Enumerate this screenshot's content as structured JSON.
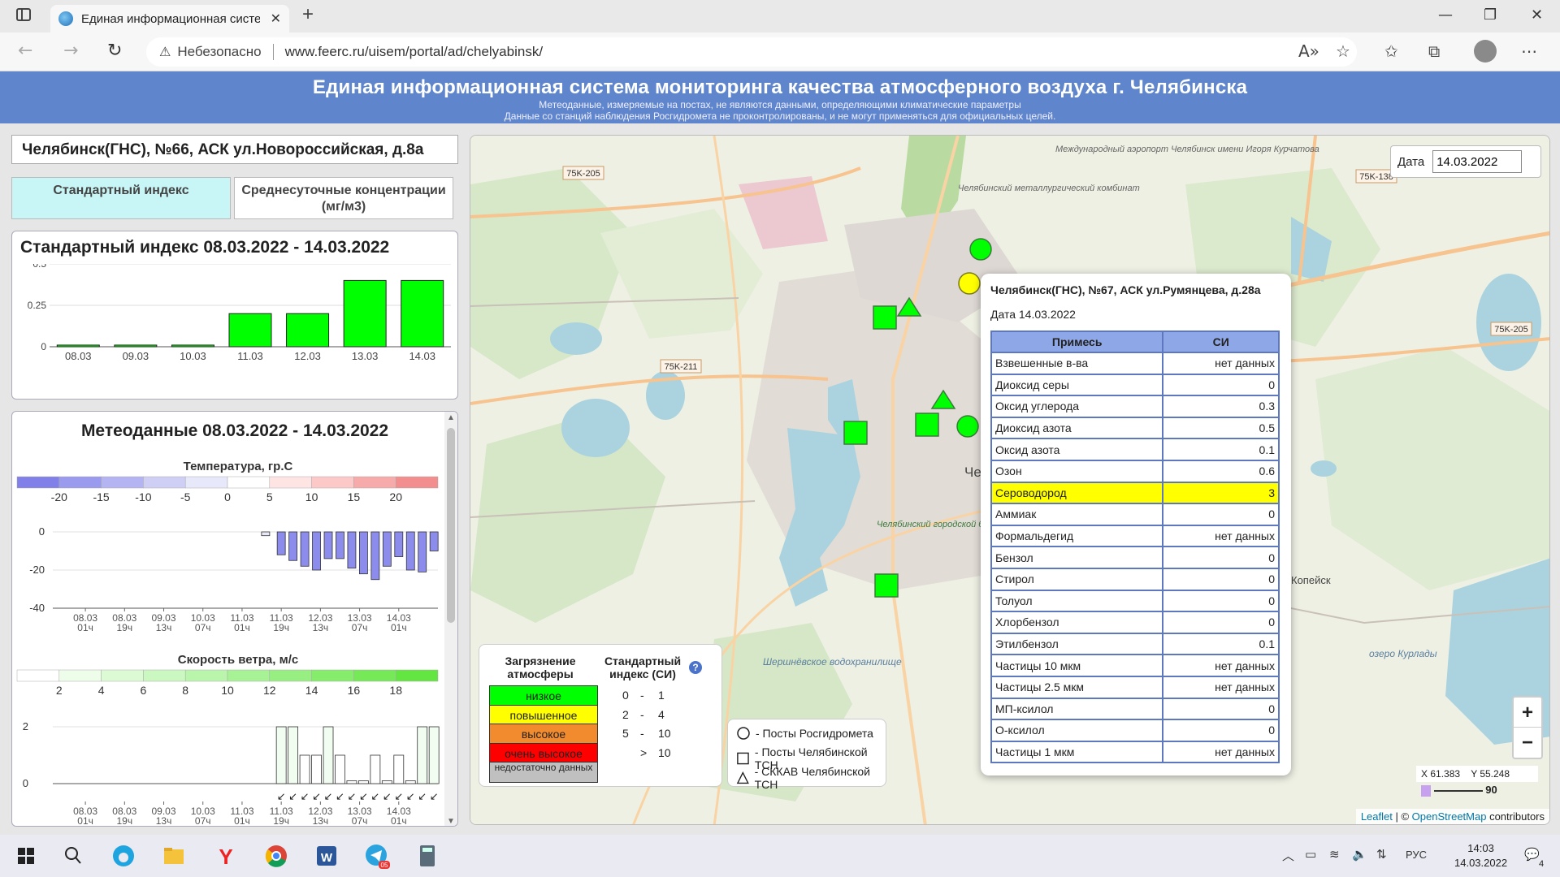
{
  "browser": {
    "tab_title": "Единая информационная систе",
    "insecure_label": "Небезопасно",
    "url": "www.feerc.ru/uisem/portal/ad/chelyabinsk/"
  },
  "page": {
    "title": "Единая информационная система мониторинга качества атмосферного воздуха г. Челябинска",
    "subtitle1": "Метеоданные, измеряемые на постах, не являются данными, определяющими климатические параметры",
    "subtitle2": "Данные со станций наблюдения Росгидромета не проконтролированы, и не могут применяться для официальных целей."
  },
  "station": {
    "title": "Челябинск(ГНС), №66, АСК ул.Новороссийская, д.8а",
    "tab_si": "Стандартный индекс",
    "tab_avg": "Среднесуточные концентрации (мг/м3)"
  },
  "si_chart_title": "Стандартный индекс 08.03.2022 - 14.03.2022",
  "meteo_title": "Метеоданные 08.03.2022 - 14.03.2022",
  "temperature": {
    "title": "Температура, гр.С",
    "scale_labels": [
      "-20",
      "-15",
      "-10",
      "-5",
      "0",
      "5",
      "10",
      "15",
      "20"
    ],
    "scale_colors": [
      "#8080e8",
      "#9a9aee",
      "#b4b4f2",
      "#cfcff6",
      "#e8e8fb",
      "#ffffff",
      "#ffe4e4",
      "#fcc8c8",
      "#f7aaaa",
      "#f28e8e"
    ]
  },
  "wind": {
    "title": "Скорость ветра, м/с",
    "scale_labels": [
      "2",
      "4",
      "6",
      "8",
      "10",
      "12",
      "14",
      "16",
      "18"
    ],
    "scale_colors": [
      "#ffffff",
      "#eefdea",
      "#dcfbd5",
      "#cbf8c0",
      "#b9f5ab",
      "#a8f296",
      "#97ef81",
      "#86ec6c",
      "#75e957",
      "#64e642"
    ]
  },
  "chart_data": [
    {
      "type": "bar",
      "title": "Стандартный индекс 08.03.2022 - 14.03.2022",
      "categories": [
        "08.03",
        "09.03",
        "10.03",
        "11.03",
        "12.03",
        "13.03",
        "14.03"
      ],
      "values": [
        0.01,
        0.01,
        0.01,
        0.2,
        0.2,
        0.4,
        0.4
      ],
      "ylim": [
        0,
        0.5
      ],
      "yticks": [
        "0",
        "0.25",
        "0.5"
      ],
      "color": "#00ff00"
    },
    {
      "type": "bar",
      "title": "Температура, гр.С",
      "x_labels": [
        [
          "08.03",
          "01ч"
        ],
        [
          "08.03",
          "19ч"
        ],
        [
          "09.03",
          "13ч"
        ],
        [
          "10.03",
          "07ч"
        ],
        [
          "11.03",
          "01ч"
        ],
        [
          "11.03",
          "19ч"
        ],
        [
          "12.03",
          "13ч"
        ],
        [
          "13.03",
          "07ч"
        ],
        [
          "14.03",
          "01ч"
        ]
      ],
      "x_range": [
        0,
        9.5
      ],
      "x": [
        5.5,
        5.8,
        6.1,
        6.4,
        6.7,
        7.0,
        7.3,
        7.6,
        7.9,
        8.2,
        8.5,
        8.8,
        9.1,
        9.4
      ],
      "values": [
        -2,
        -12,
        -15,
        -18,
        -20,
        -14,
        -14,
        -19,
        -22,
        -25,
        -18,
        -13,
        -20,
        -21,
        -10
      ],
      "yticks": [
        "0",
        "-20",
        "-40"
      ],
      "ylim": [
        -40,
        0
      ]
    },
    {
      "type": "bar",
      "title": "Скорость ветра, м/с",
      "x_labels": [
        [
          "08.03",
          "01ч"
        ],
        [
          "08.03",
          "19ч"
        ],
        [
          "09.03",
          "13ч"
        ],
        [
          "10.03",
          "07ч"
        ],
        [
          "11.03",
          "01ч"
        ],
        [
          "11.03",
          "19ч"
        ],
        [
          "12.03",
          "13ч"
        ],
        [
          "13.03",
          "07ч"
        ],
        [
          "14.03",
          "01ч"
        ]
      ],
      "x_range": [
        0,
        9.5
      ],
      "x": [
        5.5,
        5.8,
        6.1,
        6.4,
        6.7,
        7.0,
        7.3,
        7.6,
        7.9,
        8.2,
        8.5,
        8.8,
        9.1,
        9.4
      ],
      "values": [
        2,
        2,
        1,
        1,
        2,
        1,
        0.1,
        0.1,
        1,
        0.1,
        1,
        0.1,
        2,
        2
      ],
      "yticks": [
        "2",
        "0"
      ],
      "ylim": [
        0,
        2
      ]
    }
  ],
  "map": {
    "date_label": "Дата",
    "date_value": "14.03.2022",
    "road_labels": [
      "75K-205",
      "75K-138",
      "75K-211",
      "75K-205"
    ],
    "place_labels": [
      "Челябинский металлургический комбинат",
      "Международный аэропорт Челябинск имени Игоря Курчатова",
      "Челябинский городской бор",
      "Шершнёвское водохранилище",
      "Копейск",
      "озеро Курлады",
      "Чел"
    ],
    "coords": {
      "x_label": "X",
      "x_value": "61.383",
      "y_label": "Y",
      "y_value": "55.248"
    },
    "scale_value": "90",
    "attribution": {
      "leaflet": "Leaflet",
      "osm": "OpenStreetMap",
      "tail": "contributors"
    }
  },
  "popup": {
    "title": "Челябинск(ГНС), №67, АСК ул.Румянцева, д.28а",
    "date": "Дата 14.03.2022",
    "col1": "Примесь",
    "col2": "СИ",
    "rows": [
      {
        "name": "Взвешенные в-ва",
        "value": "нет данных"
      },
      {
        "name": "Диоксид серы",
        "value": "0"
      },
      {
        "name": "Оксид углерода",
        "value": "0.3"
      },
      {
        "name": "Диоксид азота",
        "value": "0.5"
      },
      {
        "name": "Оксид азота",
        "value": "0.1"
      },
      {
        "name": "Озон",
        "value": "0.6"
      },
      {
        "name": "Сероводород",
        "value": "3"
      },
      {
        "name": "Аммиак",
        "value": "0"
      },
      {
        "name": "Формальдегид",
        "value": "нет данных"
      },
      {
        "name": "Бензол",
        "value": "0"
      },
      {
        "name": "Стирол",
        "value": "0"
      },
      {
        "name": "Толуол",
        "value": "0"
      },
      {
        "name": "Хлорбензол",
        "value": "0"
      },
      {
        "name": "Этилбензол",
        "value": "0.1"
      },
      {
        "name": "Частицы 10 мкм",
        "value": "нет данных"
      },
      {
        "name": "Частицы 2.5 мкм",
        "value": "нет данных"
      },
      {
        "name": "МП-ксилол",
        "value": "0"
      },
      {
        "name": "О-ксилол",
        "value": "0"
      },
      {
        "name": "Частицы 1 мкм",
        "value": "нет данных"
      }
    ]
  },
  "legend": {
    "header1": "Загрязнение атмосферы",
    "header2": "Стандартный индекс (СИ)",
    "levels": [
      {
        "label": "низкое",
        "color": "#00ff00",
        "from": "0",
        "sep": "-",
        "to": "1"
      },
      {
        "label": "повышенное",
        "color": "#ffff00",
        "from": "2",
        "sep": "-",
        "to": "4"
      },
      {
        "label": "высокое",
        "color": "#f28a2e",
        "from": "5",
        "sep": "-",
        "to": "10"
      },
      {
        "label": "очень высокое",
        "color": "#ff0000",
        "from": "",
        "sep": ">",
        "to": "10"
      },
      {
        "label": "недостаточно данных",
        "color": "#c0c0c0",
        "from": "",
        "sep": "",
        "to": ""
      }
    ],
    "shapes": [
      {
        "symbol": "circle",
        "label": "- Посты Росгидромета"
      },
      {
        "symbol": "square",
        "label": "- Посты Челябинской ТСН"
      },
      {
        "symbol": "triangle",
        "label": "- СККАВ Челябинской ТСН"
      }
    ]
  },
  "taskbar": {
    "time": "14:03",
    "date": "14.03.2022",
    "lang": "РУС",
    "notif_count": "4",
    "telegram_badge": "05"
  }
}
